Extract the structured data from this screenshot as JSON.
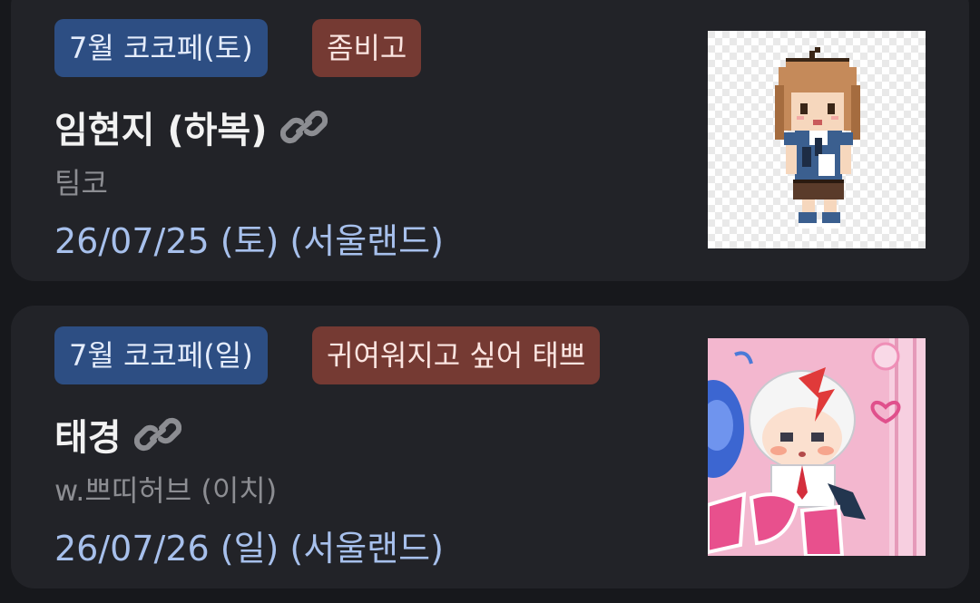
{
  "items": [
    {
      "event_tag": "7월 코코페(토)",
      "group_tag": "좀비고",
      "title": "임현지 (하복)",
      "link_icon": "link-icon",
      "author": "팀코",
      "date": "26/07/25 (토) (서울랜드)"
    },
    {
      "event_tag": "7월 코코페(일)",
      "group_tag": "귀여워지고 싶어 태쁘",
      "title": "태경",
      "link_icon": "link-icon",
      "author": "w.쁘띠허브 (이치)",
      "date": "26/07/26 (일) (서울랜드)"
    }
  ],
  "colors": {
    "background": "#17181c",
    "card": "#222328",
    "event_tag": "#2d4e83",
    "group_tag": "#753a33",
    "date": "#a7c0ec"
  }
}
